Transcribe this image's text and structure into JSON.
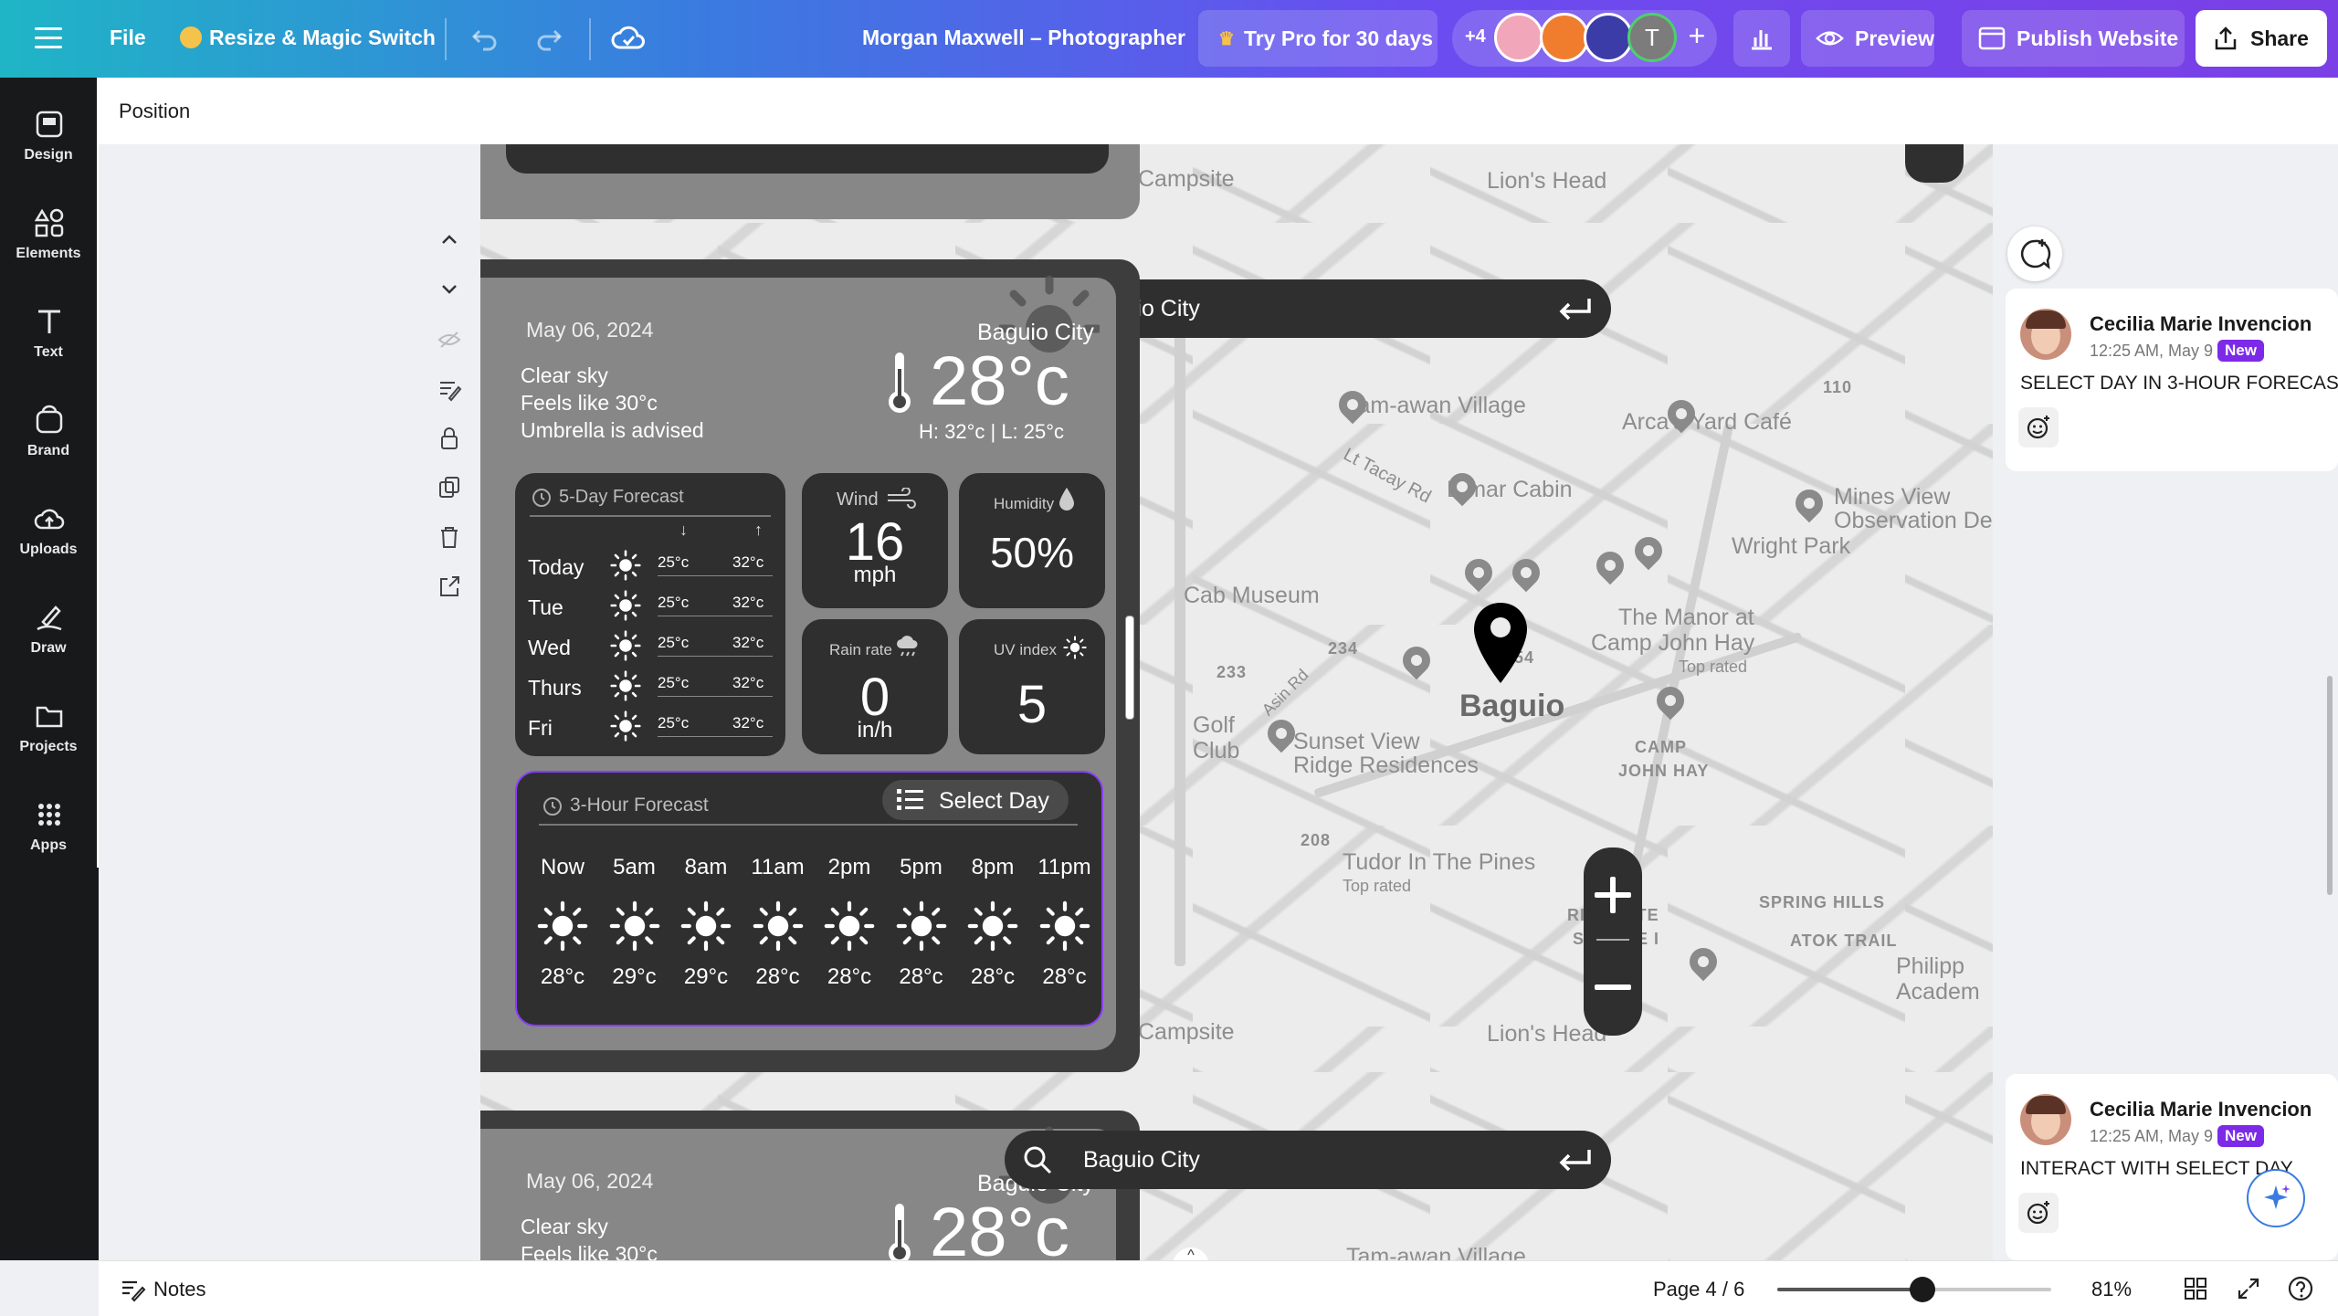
{
  "topbar": {
    "file_label": "File",
    "resize_label": "Resize & Magic Switch",
    "doc_title": "Morgan Maxwell – Photographer",
    "try_pro_label": "Try Pro for 30 days",
    "extra_collaborators": "+4",
    "avatar_letter": "T",
    "preview_label": "Preview",
    "publish_label": "Publish Website",
    "share_label": "Share"
  },
  "rail": {
    "items": [
      {
        "label": "Design"
      },
      {
        "label": "Elements"
      },
      {
        "label": "Text"
      },
      {
        "label": "Brand"
      },
      {
        "label": "Uploads"
      },
      {
        "label": "Draw"
      },
      {
        "label": "Projects"
      },
      {
        "label": "Apps"
      }
    ]
  },
  "header": {
    "position_label": "Position"
  },
  "weather": {
    "date": "May 06, 2024",
    "city": "Baguio City",
    "condition": "Clear sky",
    "feels_like": "Feels like 30°c",
    "advice": "Umbrella is advised",
    "temp": "28°c",
    "hilo": "H:  32°c | L: 25°c",
    "five_day": {
      "title": "5-Day Forecast",
      "days": [
        {
          "day": "Today",
          "low": "25°c",
          "high": "32°c"
        },
        {
          "day": "Tue",
          "low": "25°c",
          "high": "32°c"
        },
        {
          "day": "Wed",
          "low": "25°c",
          "high": "32°c"
        },
        {
          "day": "Thurs",
          "low": "25°c",
          "high": "32°c"
        },
        {
          "day": "Fri",
          "low": "25°c",
          "high": "32°c"
        }
      ]
    },
    "wind": {
      "label": "Wind",
      "value": "16",
      "unit": "mph"
    },
    "humidity": {
      "label": "Humidity",
      "value": "50%"
    },
    "rain": {
      "label": "Rain rate",
      "value": "0",
      "unit": "in/h"
    },
    "uv": {
      "label": "UV index",
      "value": "5"
    },
    "three_hour": {
      "title": "3-Hour Forecast",
      "select_label": "Select Day",
      "hours": [
        {
          "time": "Now",
          "temp": "28°c"
        },
        {
          "time": "5am",
          "temp": "29°c"
        },
        {
          "time": "8am",
          "temp": "29°c"
        },
        {
          "time": "11am",
          "temp": "28°c"
        },
        {
          "time": "2pm",
          "temp": "28°c"
        },
        {
          "time": "5pm",
          "temp": "28°c"
        },
        {
          "time": "8pm",
          "temp": "28°c"
        },
        {
          "time": "11pm",
          "temp": "28°c"
        }
      ]
    }
  },
  "map": {
    "search_value": "Baguio City",
    "labels": {
      "campsite": "Campsite",
      "lions_head": "Lion's Head",
      "tamawan": "Tam-awan Village",
      "arcas": "Arca's Yard Café",
      "tacay": "Lt Tacay Rd",
      "elmar": "Elmar Cabin",
      "mines_view": "Mines View",
      "observation": "Observation Dec",
      "wright": "Wright Park",
      "cab_museum": "Cab Museum",
      "manor": "The Manor at",
      "camp_john": "Camp John Hay",
      "top_rated": "Top rated",
      "baguio": "Baguio",
      "golf": "Golf",
      "club": "Club",
      "asin": "Asin Rd",
      "sunset": "Sunset View",
      "ridge": "Ridge Residences",
      "camp_john_caps": "CAMP",
      "john_hay_caps": "JOHN HAY",
      "tudor": "Tudor In The Pines",
      "richgate": "RICHGATE",
      "square": "SQUARE I",
      "spring_hills": "SPRING HILLS",
      "atok": "ATOK TRAIL",
      "philipp": "Philipp",
      "academ": "Academ",
      "road_110": "110",
      "road_234": "234",
      "road_233": "233",
      "road_208": "208",
      "road_54": "54"
    }
  },
  "comments": [
    {
      "author": "Cecilia Marie Invencion",
      "time": "12:25 AM, May 9",
      "badge": "New",
      "text": "SELECT DAY IN 3-HOUR FORECAS"
    },
    {
      "author": "Cecilia Marie Invencion",
      "time": "12:25 AM, May 9",
      "badge": "New",
      "text": "INTERACT WITH SELECT DAY"
    }
  ],
  "bottom": {
    "notes_label": "Notes",
    "page_label": "Page 4 / 6",
    "zoom_label": "81%",
    "zoom_fraction": 0.53
  },
  "colors": {
    "accent_purple": "#7d2ae8",
    "card_dark": "#2f2f2f",
    "card_mid": "#878787"
  }
}
